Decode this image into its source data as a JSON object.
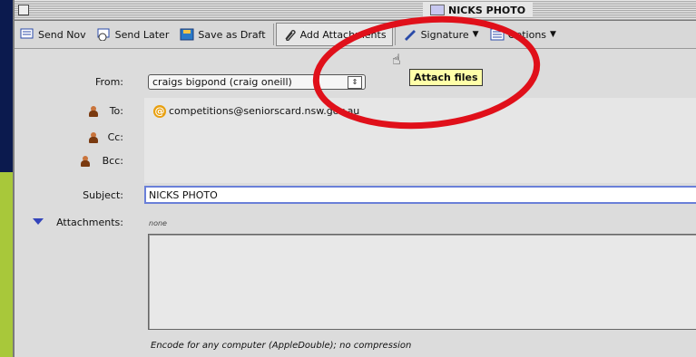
{
  "window": {
    "title": "NICKS PHOTO"
  },
  "toolbar": {
    "send_now": "Send Nov",
    "send_later": "Send Later",
    "save_draft": "Save as Draft",
    "add_attachments": "Add Attachments",
    "signature": "Signature",
    "options": "Options"
  },
  "tooltip": {
    "text": "Attach files"
  },
  "headers": {
    "from_label": "From:",
    "from_value": "craigs bigpond (craig oneill)",
    "to_label": "To:",
    "to_value": "competitions@seniorscard.nsw.gov.au",
    "cc_label": "Cc:",
    "bcc_label": "Bcc:",
    "subject_label": "Subject:",
    "subject_value": "NICKS PHOTO"
  },
  "attachments": {
    "label": "Attachments:",
    "count_text": "none",
    "encoding": "Encode for any computer (AppleDouble); no compression"
  },
  "colors": {
    "annotation": "#e0101a",
    "background": "#0b1a4e",
    "accent_green": "#a8c83a"
  },
  "icons": [
    "send-now-icon",
    "send-later-icon",
    "save-draft-icon",
    "paperclip-icon",
    "signature-icon",
    "options-icon",
    "person-icon",
    "at-icon"
  ]
}
